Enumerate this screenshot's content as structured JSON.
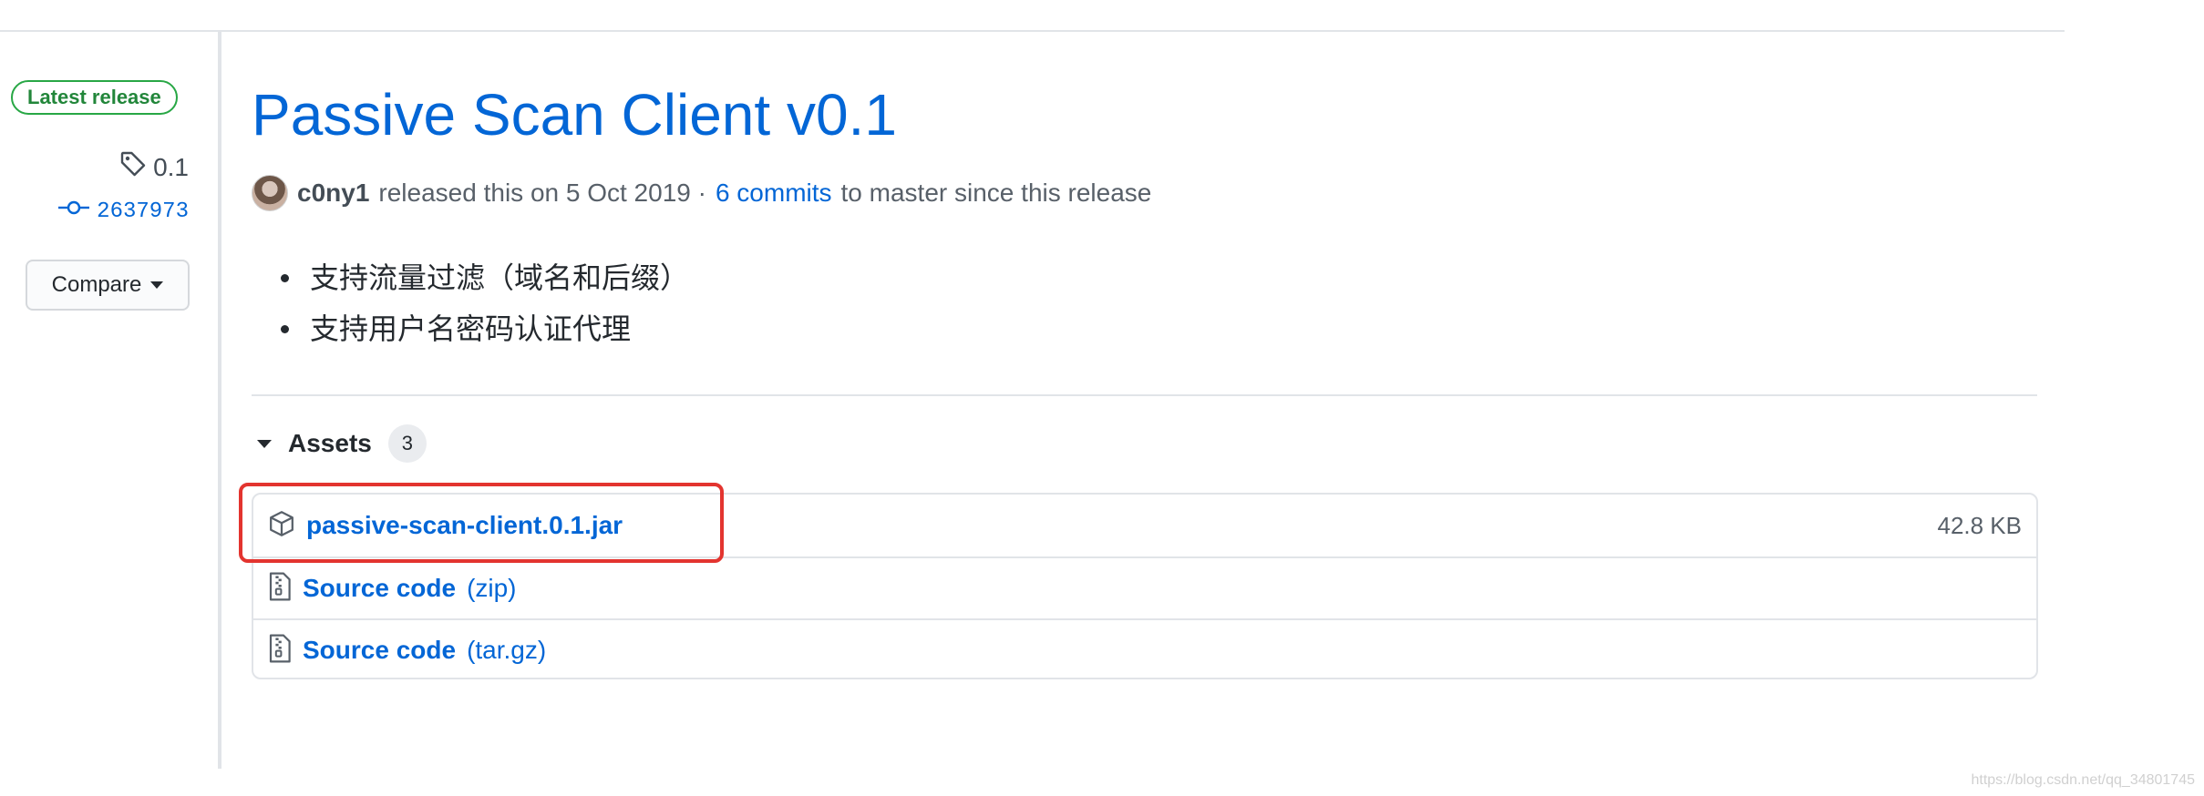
{
  "sidebar": {
    "latest_badge": "Latest release",
    "tag": "0.1",
    "commit": "2637973",
    "compare_label": "Compare"
  },
  "release": {
    "title": "Passive Scan Client v0.1",
    "author": "c0ny1",
    "released_text": "released this on 5 Oct 2019 ·",
    "commits_link": "6 commits",
    "since_text": "to master since this release",
    "notes": [
      "支持流量过滤（域名和后缀）",
      "支持用户名密码认证代理"
    ]
  },
  "assets": {
    "header": "Assets",
    "count": "3",
    "items": [
      {
        "name": "passive-scan-client.0.1.jar",
        "ext": "",
        "size": "42.8 KB",
        "icon": "package-icon"
      },
      {
        "name": "Source code",
        "ext": "(zip)",
        "size": "",
        "icon": "file-zip-icon"
      },
      {
        "name": "Source code",
        "ext": "(tar.gz)",
        "size": "",
        "icon": "file-zip-icon"
      }
    ]
  },
  "annotation": {
    "highlight_color": "#e3342f"
  },
  "colors": {
    "link": "#0366d6",
    "badge_green": "#28a745"
  },
  "watermark": "https://blog.csdn.net/qq_34801745"
}
